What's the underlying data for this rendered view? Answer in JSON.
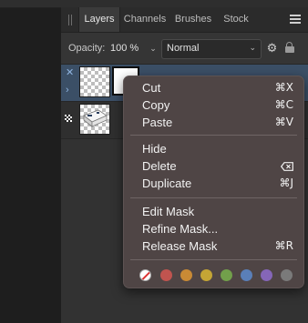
{
  "tabs": [
    {
      "label": "Layers",
      "active": true
    },
    {
      "label": "Channels",
      "active": false
    },
    {
      "label": "Brushes",
      "active": false
    },
    {
      "label": "Stock",
      "active": false
    }
  ],
  "options": {
    "opacity_label": "Opacity:",
    "opacity_value": "100 %",
    "blend_mode": "Normal"
  },
  "layers": [
    {
      "selected": true,
      "has_mask": true
    },
    {
      "selected": false,
      "has_mask": false
    }
  ],
  "context_menu": {
    "groups": [
      [
        {
          "label": "Cut",
          "shortcut": "⌘X"
        },
        {
          "label": "Copy",
          "shortcut": "⌘C"
        },
        {
          "label": "Paste",
          "shortcut": "⌘V"
        }
      ],
      [
        {
          "label": "Hide",
          "shortcut": ""
        },
        {
          "label": "Delete",
          "shortcut": "delete-key-icon"
        },
        {
          "label": "Duplicate",
          "shortcut": "⌘J"
        }
      ],
      [
        {
          "label": "Edit Mask",
          "shortcut": ""
        },
        {
          "label": "Refine Mask...",
          "shortcut": ""
        },
        {
          "label": "Release Mask",
          "shortcut": "⌘R"
        }
      ]
    ],
    "color_tags": [
      "none",
      "#c0544f",
      "#c98a35",
      "#c4a535",
      "#72a04b",
      "#5a7fb8",
      "#8566b8",
      "#7a7a7a"
    ]
  }
}
